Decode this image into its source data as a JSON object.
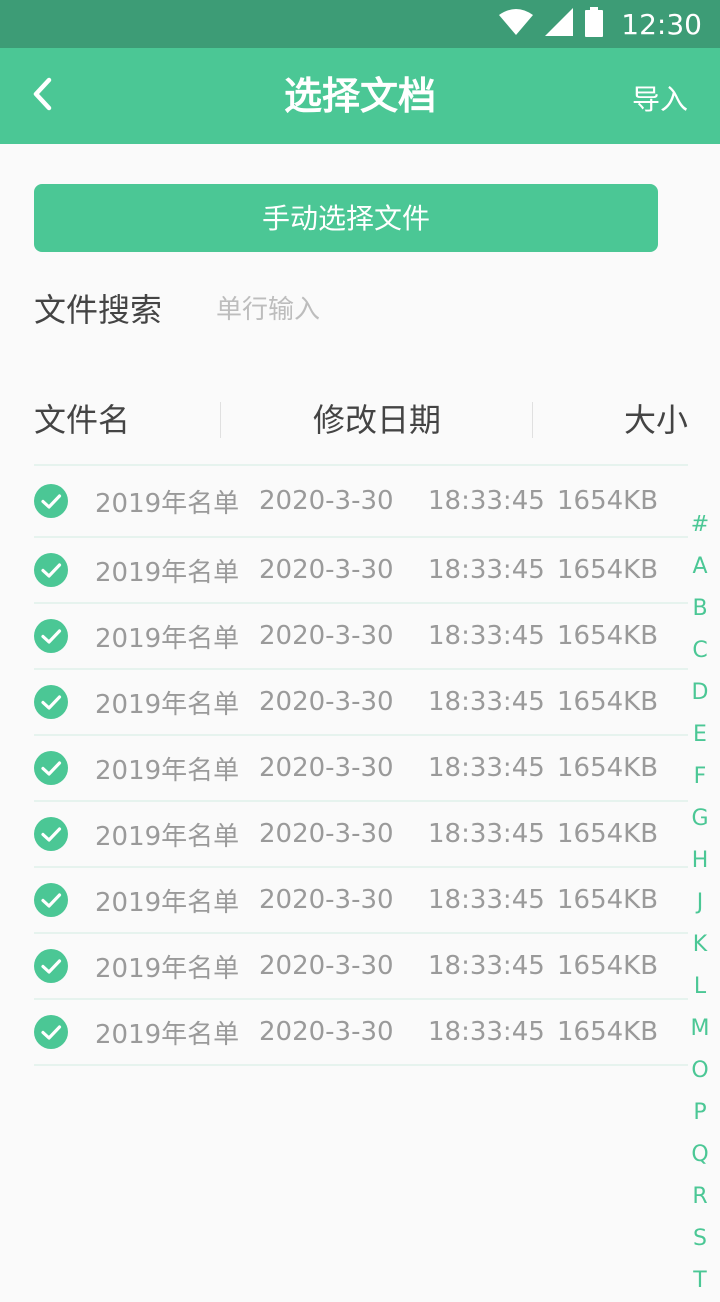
{
  "status_bar": {
    "time": "12:30",
    "icons": [
      "wifi-icon",
      "signal-icon",
      "battery-icon"
    ]
  },
  "app_bar": {
    "title": "选择文档",
    "back_icon": "chevron-left-icon",
    "action_label": "导入"
  },
  "manual_select_label": "手动选择文件",
  "search": {
    "label": "文件搜索",
    "placeholder": "单行输入",
    "value": ""
  },
  "table": {
    "headers": {
      "name": "文件名",
      "date": "修改日期",
      "size": "大小"
    },
    "rows": [
      {
        "name": "2019年名单",
        "date": "2020-3-30",
        "time": "18:33:45",
        "size": "1654KB",
        "checked": true
      },
      {
        "name": "2019年名单",
        "date": "2020-3-30",
        "time": "18:33:45",
        "size": "1654KB",
        "checked": true
      },
      {
        "name": "2019年名单",
        "date": "2020-3-30",
        "time": "18:33:45",
        "size": "1654KB",
        "checked": true
      },
      {
        "name": "2019年名单",
        "date": "2020-3-30",
        "time": "18:33:45",
        "size": "1654KB",
        "checked": true
      },
      {
        "name": "2019年名单",
        "date": "2020-3-30",
        "time": "18:33:45",
        "size": "1654KB",
        "checked": true
      },
      {
        "name": "2019年名单",
        "date": "2020-3-30",
        "time": "18:33:45",
        "size": "1654KB",
        "checked": true
      },
      {
        "name": "2019年名单",
        "date": "2020-3-30",
        "time": "18:33:45",
        "size": "1654KB",
        "checked": true
      },
      {
        "name": "2019年名单",
        "date": "2020-3-30",
        "time": "18:33:45",
        "size": "1654KB",
        "checked": true
      },
      {
        "name": "2019年名单",
        "date": "2020-3-30",
        "time": "18:33:45",
        "size": "1654KB",
        "checked": true
      }
    ]
  },
  "alphabet_index": [
    "#",
    "A",
    "B",
    "C",
    "D",
    "E",
    "F",
    "G",
    "H",
    "J",
    "K",
    "L",
    "M",
    "O",
    "P",
    "Q",
    "R",
    "S",
    "T"
  ],
  "colors": {
    "status_bar": "#3d9c76",
    "primary": "#4bc795",
    "text_dark": "#444444",
    "text_muted": "#9a9a9a",
    "placeholder": "#bdbdbd",
    "divider": "#e6f3ee"
  }
}
